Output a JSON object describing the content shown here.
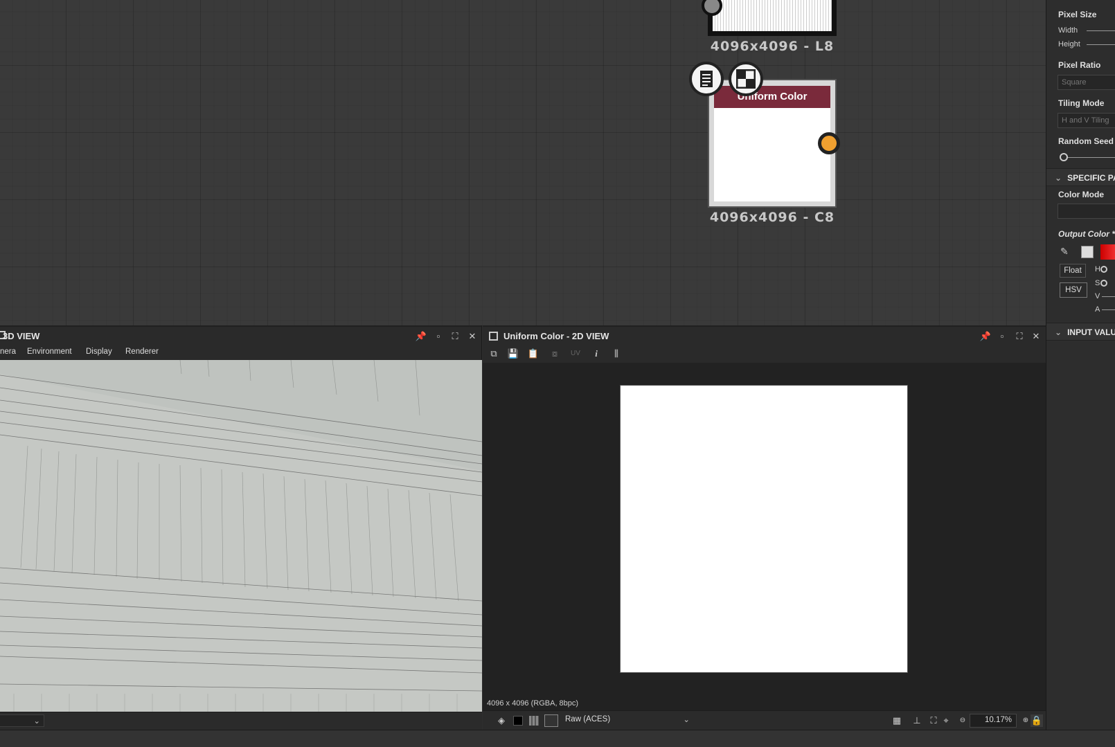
{
  "graph": {
    "top_node_resolution": "4096x4096 - L8",
    "uniform_node": {
      "title": "Uniform Color",
      "resolution": "4096x4096 - C8",
      "icons": [
        "document-icon",
        "checker-icon"
      ],
      "output_color": "#f0a030",
      "header_color": "#7a2a3b"
    }
  },
  "properties": {
    "pixel_size": "Pixel Size",
    "width": "Width",
    "height": "Height",
    "pixel_ratio": "Pixel Ratio",
    "pixel_ratio_value": "Square",
    "tiling_mode": "Tiling Mode",
    "tiling_mode_value": "H and V Tiling",
    "random_seed": "Random Seed",
    "specific_section": "SPECIFIC PA",
    "color_mode": "Color Mode",
    "output_color": "Output Color *",
    "float_btn": "Float",
    "hsv_btn": "HSV",
    "h": "H",
    "s": "S",
    "v": "V",
    "a": "A",
    "input_section": "INPUT VALU"
  },
  "view3d": {
    "title": "3D VIEW",
    "menu": [
      "nera",
      "Environment",
      "Display",
      "Renderer"
    ]
  },
  "view2d": {
    "title": "Uniform Color - 2D VIEW",
    "uv_label": "UV",
    "info": "4096 x 4096 (RGBA, 8bpc)",
    "colorspace": "Raw (ACES)",
    "zoom": "10.17%"
  }
}
